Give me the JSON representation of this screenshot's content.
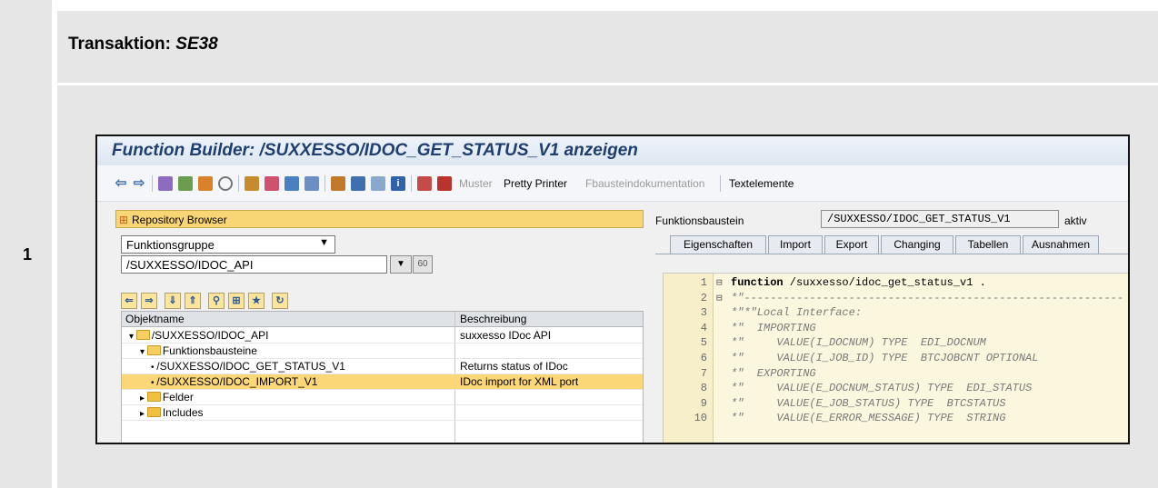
{
  "step": {
    "number": "1"
  },
  "heading": {
    "prefix": "Transaktion:",
    "code": "SE38"
  },
  "window": {
    "title": "Function Builder: /SUXXESSO/IDOC_GET_STATUS_V1 anzeigen",
    "toolbar": {
      "buttons": [
        "back-icon",
        "forward-icon",
        "check-icon",
        "activate-icon",
        "copy-icon",
        "where-used-icon",
        "hierarchy-icon",
        "edit-icon",
        "test-icon",
        "other-object-icon",
        "object-list-icon",
        "display-icon",
        "layout-icon",
        "info-icon",
        "network-icon",
        "stop-icon"
      ],
      "muster": "Muster",
      "pretty_printer": "Pretty Printer",
      "fb_doc": "Fbausteindokumentation",
      "text_elements": "Textelemente"
    }
  },
  "repository": {
    "header": "Repository Browser",
    "object_type": "Funktionsgruppe",
    "object_name": "/SUXXESSO/IDOC_API",
    "columns": {
      "name": "Objektname",
      "description": "Beschreibung"
    },
    "rows": [
      {
        "name": "/SUXXESSO/IDOC_API",
        "description": "suxxesso IDoc API",
        "indent": 0,
        "marker": "▾",
        "folder": "open"
      },
      {
        "name": "Funktionsbausteine",
        "description": "",
        "indent": 1,
        "marker": "▾",
        "folder": "open"
      },
      {
        "name": "/SUXXESSO/IDOC_GET_STATUS_V1",
        "description": "Returns status of IDoc",
        "indent": 2,
        "marker": "•",
        "folder": ""
      },
      {
        "name": "/SUXXESSO/IDOC_IMPORT_V1",
        "description": "IDoc import for XML port",
        "indent": 2,
        "marker": "•",
        "folder": "",
        "selected": true
      },
      {
        "name": "Felder",
        "description": "",
        "indent": 1,
        "marker": "▸",
        "folder": "closed"
      },
      {
        "name": "Includes",
        "description": "",
        "indent": 1,
        "marker": "▸",
        "folder": "closed"
      }
    ]
  },
  "function_module": {
    "label": "Funktionsbaustein",
    "name": "/SUXXESSO/IDOC_GET_STATUS_V1",
    "status": "aktiv",
    "tabs": [
      "Eigenschaften",
      "Import",
      "Export",
      "Changing",
      "Tabellen",
      "Ausnahmen"
    ]
  },
  "code": [
    {
      "ln": "1",
      "fold": "⊟",
      "keyword": "function",
      "text": " /suxxesso/idoc_get_status_v1 .",
      "comment": false
    },
    {
      "ln": "2",
      "fold": "⊟",
      "keyword": "",
      "text": "*\"----------------------------------------------------------",
      "comment": true
    },
    {
      "ln": "3",
      "fold": "",
      "keyword": "",
      "text": "*\"*\"Local Interface:",
      "comment": true
    },
    {
      "ln": "4",
      "fold": "",
      "keyword": "",
      "text": "*\"  IMPORTING",
      "comment": true
    },
    {
      "ln": "5",
      "fold": "",
      "keyword": "",
      "text": "*\"     VALUE(I_DOCNUM) TYPE  EDI_DOCNUM",
      "comment": true
    },
    {
      "ln": "6",
      "fold": "",
      "keyword": "",
      "text": "*\"     VALUE(I_JOB_ID) TYPE  BTCJOBCNT OPTIONAL",
      "comment": true
    },
    {
      "ln": "7",
      "fold": "",
      "keyword": "",
      "text": "*\"  EXPORTING",
      "comment": true
    },
    {
      "ln": "8",
      "fold": "",
      "keyword": "",
      "text": "*\"     VALUE(E_DOCNUM_STATUS) TYPE  EDI_STATUS",
      "comment": true
    },
    {
      "ln": "9",
      "fold": "",
      "keyword": "",
      "text": "*\"     VALUE(E_JOB_STATUS) TYPE  BTCSTATUS",
      "comment": true
    },
    {
      "ln": "10",
      "fold": "",
      "keyword": "",
      "text": "*\"     VALUE(E_ERROR_MESSAGE) TYPE  STRING",
      "comment": true
    }
  ]
}
